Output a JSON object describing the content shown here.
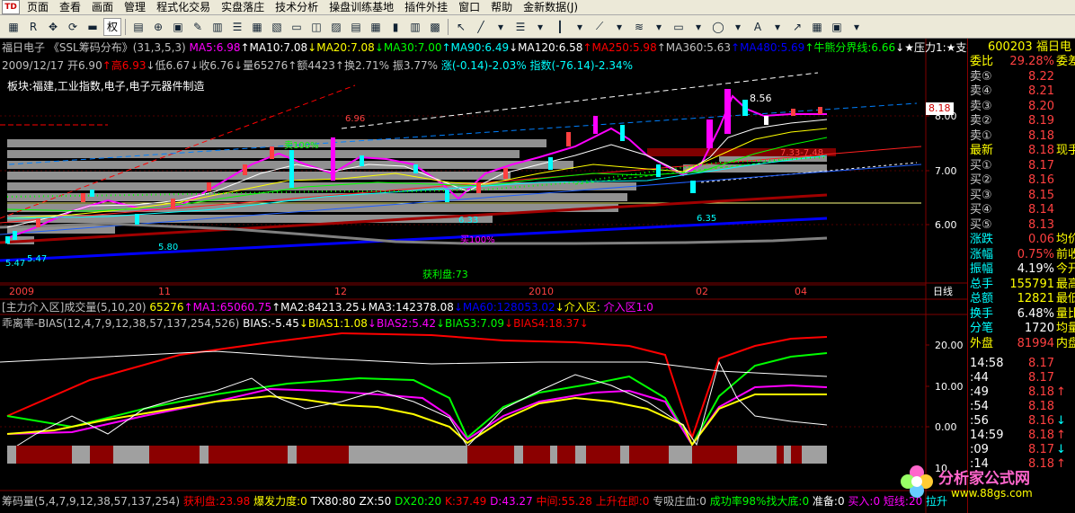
{
  "menu": {
    "logo": "TD",
    "items": [
      "页面",
      "查看",
      "画面",
      "管理",
      "程式化交易",
      "实盘落庄",
      "技术分析",
      "操盘训练基地",
      "插件外挂",
      "窗口",
      "帮助",
      "金新数据(J)"
    ]
  },
  "toolbar": {
    "quan_label": "权"
  },
  "header": {
    "line1": [
      {
        "text": "福日电子 《SSL筹码分布》(31,3,5,3)",
        "color": "#c0c0c0"
      },
      {
        "text": " MA5:6.98",
        "color": "#ff00ff"
      },
      {
        "text": "↑MA10:7.08",
        "color": "#ffffff"
      },
      {
        "text": "↓MA20:7.08",
        "color": "#ffff00"
      },
      {
        "text": "↓MA30:7.00",
        "color": "#00ff00"
      },
      {
        "text": "↑MA90:6.49",
        "color": "#00ffff"
      },
      {
        "text": "↓MA120:6.58",
        "color": "#ffffff"
      },
      {
        "text": "↑MA250:5.98",
        "color": "#ff0000"
      },
      {
        "text": "↑MA360:5.63",
        "color": "#c0c0c0"
      },
      {
        "text": "↑MA480:5.69",
        "color": "#0000ff"
      },
      {
        "text": "↑牛熊分界线:6.66",
        "color": "#00ff00"
      },
      {
        "text": "↓★压力1:★支撑1:★",
        "color": "#ffffff"
      },
      {
        "text": "压",
        "color": "#0000ff"
      }
    ],
    "line2": [
      {
        "text": "2009/12/17 开6.90",
        "color": "#c0c0c0"
      },
      {
        "text": "↑高6.93",
        "color": "#ff0000"
      },
      {
        "text": "↓低6.67",
        "color": "#c0c0c0"
      },
      {
        "text": "↓收6.76",
        "color": "#c0c0c0"
      },
      {
        "text": "↓量65276",
        "color": "#c0c0c0"
      },
      {
        "text": "↑额4423",
        "color": "#c0c0c0"
      },
      {
        "text": "↑换2.71%",
        "color": "#c0c0c0"
      },
      {
        "text": " 振3.77%",
        "color": "#c0c0c0"
      },
      {
        "text": " 涨(-0.14)-2.03%",
        "color": "#00ffff"
      },
      {
        "text": " 指数(-76.14)-2.34%",
        "color": "#00ffff"
      }
    ],
    "sector": "板块:福建,工业指数,电子,电子元器件制造"
  },
  "price_chart": {
    "y_ticks": [
      "8.00",
      "7.00",
      "6.00"
    ],
    "current_price_label": "8.18",
    "x_ticks": [
      "2009",
      "11",
      "12",
      "2010",
      "02",
      "04"
    ],
    "period_label": "日线",
    "annotations": {
      "high1": "8.56",
      "high2": "6.96",
      "low1": "6.33",
      "low2": "5.80",
      "low3": "5.47",
      "low4": "6.35",
      "range": "7.33-7.48",
      "sell100": "卖100%",
      "buy100": "买100%",
      "profit": "获利盘:73",
      "left_low": "5.47"
    }
  },
  "volume_bar": {
    "parts": [
      {
        "text": "[主力介入区]成交量(5,10,20)",
        "color": "#c0c0c0"
      },
      {
        "text": " 65276",
        "color": "#ffff00"
      },
      {
        "text": "↑MA1:65060.75",
        "color": "#ff00ff"
      },
      {
        "text": "↑MA2:84213.25",
        "color": "#ffffff"
      },
      {
        "text": "↓MA3:142378.08",
        "color": "#ffffff"
      },
      {
        "text": "↓MA60:128053.02",
        "color": "#0000ff"
      },
      {
        "text": "↓介入区:",
        "color": "#ffff00"
      },
      {
        "text": " 介入区1:0",
        "color": "#ff00ff"
      }
    ]
  },
  "bias": {
    "title_parts": [
      {
        "text": "乖离率-BIAS(12,4,7,9,12,38,57,137,254,526)",
        "color": "#c0c0c0"
      },
      {
        "text": " BIAS:-5.45",
        "color": "#ffffff"
      },
      {
        "text": "↓BIAS1:1.08",
        "color": "#ffff00"
      },
      {
        "text": "↓BIAS2:5.42",
        "color": "#ff00ff"
      },
      {
        "text": "↓BIAS3:7.09",
        "color": "#00ff00"
      },
      {
        "text": "↓BIAS4:18.37",
        "color": "#ff0000"
      },
      {
        "text": "↓",
        "color": "#ff0000"
      }
    ],
    "y_ticks": [
      "20.00",
      "10.00",
      "0.00"
    ],
    "bottom_tick": "10"
  },
  "footer": {
    "parts": [
      {
        "text": "筹码量(5,4,7,9,12,38,57,137,254)",
        "color": "#c0c0c0"
      },
      {
        "text": " 获利盘:23.98",
        "color": "#ff0000"
      },
      {
        "text": " 爆发力度:0",
        "color": "#ffff00"
      },
      {
        "text": " TX80:80",
        "color": "#ffffff"
      },
      {
        "text": " ZX:50",
        "color": "#ffffff"
      },
      {
        "text": " DX20:20",
        "color": "#00ff00"
      },
      {
        "text": " K:37.49",
        "color": "#ff0000"
      },
      {
        "text": " D:43.27",
        "color": "#ff00ff"
      },
      {
        "text": " 中间:55.28",
        "color": "#ff0000"
      },
      {
        "text": " 上升在即:0",
        "color": "#ff0000"
      },
      {
        "text": " 专吸庄血:0",
        "color": "#c0c0c0"
      },
      {
        "text": " 成功率98%找大底:0",
        "color": "#00ff00"
      },
      {
        "text": " 准备:0",
        "color": "#ffffff"
      },
      {
        "text": " 买入:0",
        "color": "#ff00ff"
      },
      {
        "text": " 短线:20",
        "color": "#ff00ff"
      },
      {
        "text": " 拉升",
        "color": "#00ffff"
      }
    ]
  },
  "quote_panel": {
    "code": "600203",
    "name": "福日电",
    "weibi": {
      "k": "委比",
      "v": "29.28%",
      "x": "委差"
    },
    "asks": [
      {
        "k": "卖⑤",
        "v": "8.22",
        "x": ""
      },
      {
        "k": "卖④",
        "v": "8.21",
        "x": ""
      },
      {
        "k": "卖③",
        "v": "8.20",
        "x": ""
      },
      {
        "k": "卖②",
        "v": "8.19",
        "x": ""
      },
      {
        "k": "卖①",
        "v": "8.18",
        "x": ""
      }
    ],
    "latest": {
      "k": "最新",
      "v": "8.18",
      "x": "现手"
    },
    "bids": [
      {
        "k": "买①",
        "v": "8.17",
        "x": ""
      },
      {
        "k": "买②",
        "v": "8.16",
        "x": ""
      },
      {
        "k": "买③",
        "v": "8.15",
        "x": ""
      },
      {
        "k": "买④",
        "v": "8.14",
        "x": ""
      },
      {
        "k": "买⑤",
        "v": "8.13",
        "x": ""
      }
    ],
    "stats": [
      {
        "k": "涨跌",
        "v": "0.06",
        "x": "均价"
      },
      {
        "k": "涨幅",
        "v": "0.75%",
        "x": "前收"
      },
      {
        "k": "振幅",
        "v": "4.19%",
        "x": "今开"
      },
      {
        "k": "总手",
        "v": "155791",
        "x": "最高"
      },
      {
        "k": "总额",
        "v": "12821",
        "x": "最低"
      },
      {
        "k": "换手",
        "v": "6.48%",
        "x": "量比"
      },
      {
        "k": "分笔",
        "v": "1720",
        "x": "均量"
      }
    ],
    "outer": {
      "k": "外盘",
      "v": "81994",
      "x": "内盘"
    },
    "ticks": [
      {
        "t": "14:58",
        "p": "8.17",
        "a": ""
      },
      {
        "t": ":44",
        "p": "8.17",
        "a": ""
      },
      {
        "t": ":49",
        "p": "8.18",
        "a": "↑"
      },
      {
        "t": ":54",
        "p": "8.18",
        "a": ""
      },
      {
        "t": ":56",
        "p": "8.16",
        "a": "↓"
      },
      {
        "t": "14:59",
        "p": "8.18",
        "a": "↑"
      },
      {
        "t": ":09",
        "p": "8.17",
        "a": "↓"
      },
      {
        "t": ":14",
        "p": "8.18",
        "a": "↑"
      }
    ]
  },
  "watermark": {
    "name": "分析家公式网",
    "url": "www.88gs.com"
  }
}
